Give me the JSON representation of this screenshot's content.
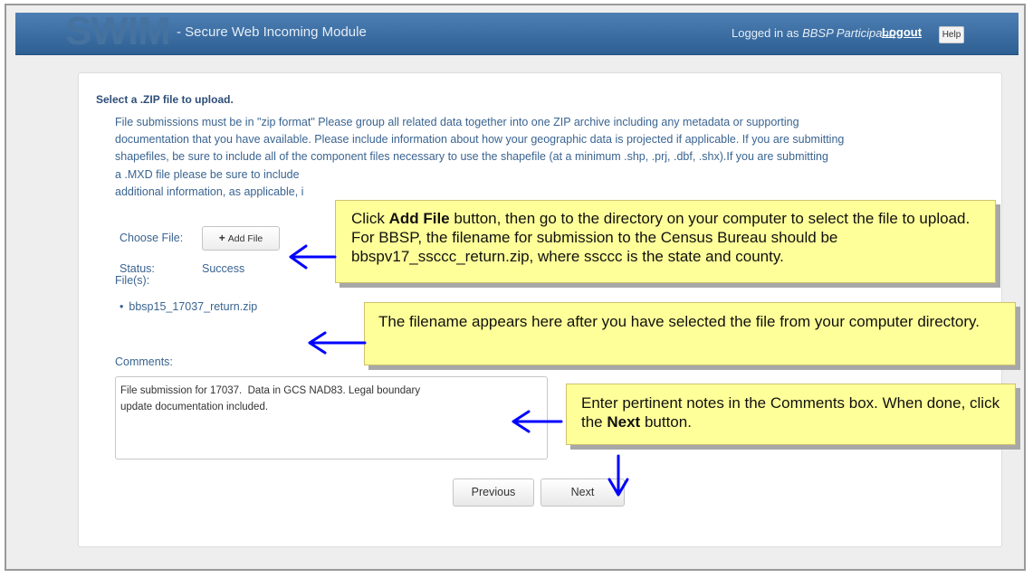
{
  "header": {
    "logo": "SWIM",
    "subtitle": "- Secure Web Incoming Module",
    "login_prefix": "Logged in as",
    "user": "BBSP Participant",
    "login_suffix": ",",
    "logout": "Logout",
    "help": "Help"
  },
  "main": {
    "heading": "Select a .ZIP file to upload.",
    "instructions": [
      "File submissions must be in \"zip format\" Please group all related data together into one ZIP archive including any metadata or supporting",
      "documentation that you have available. Please include information about how your geographic data is projected if applicable. If you are submitting",
      "shapefiles, be sure to include all of the component files necessary to use the shapefile (at a minimum .shp, .prj, .dbf, .shx).If you are submitting",
      "a .MXD file please be sure to include",
      "additional information, as applicable, i"
    ],
    "choose_file_label": "Choose File:",
    "add_file_icon": "plus-icon",
    "add_file_label": "Add File",
    "status_label": "Status:",
    "status_value": "Success",
    "files_label": "File(s):",
    "files": [
      "bbsp15_17037_return.zip"
    ],
    "comments_label": "Comments:",
    "comments_value": "File submission for 17037.  Data in GCS NAD83. Legal boundary\nupdate documentation included.",
    "previous_button": "Previous",
    "next_button": "Next"
  },
  "callouts": {
    "add_file": {
      "t1": "Click ",
      "b1": "Add File",
      "t2": " button, then go to the directory on your computer to select the file to upload. For BBSP, the filename for submission to the Census Bureau should be bbspv17_ssccc_return.zip, where ssccc is the state and county."
    },
    "filename": {
      "text": "The filename appears here after you have selected the file from your computer directory."
    },
    "comments": {
      "t1": "Enter pertinent notes in the Comments box. When done, click the ",
      "b1": "Next",
      "t2": " button."
    }
  },
  "colors": {
    "header_blue": "#2d5f93",
    "text_blue": "#3a6491",
    "callout_yellow": "#ffff99",
    "arrow_blue": "#0000ff"
  }
}
